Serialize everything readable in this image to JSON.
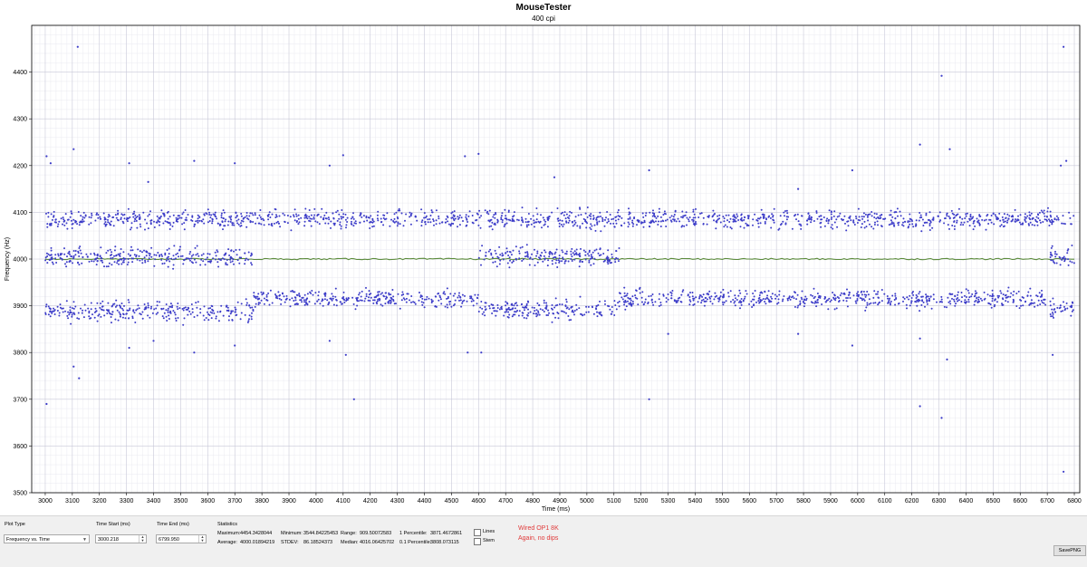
{
  "chart_data": {
    "type": "scatter",
    "title": "MouseTester",
    "subtitle": "400 cpi",
    "xlabel": "Time (ms)",
    "ylabel": "Frequency (Hz)",
    "xlim": [
      2950,
      6820
    ],
    "ylim": [
      3500,
      4500
    ],
    "x_ticks": [
      "3000",
      "3100",
      "3200",
      "3300",
      "3400",
      "3500",
      "3600",
      "3700",
      "3800",
      "3900",
      "4000",
      "4100",
      "4200",
      "4300",
      "4400",
      "4500",
      "4600",
      "4700",
      "4800",
      "4900",
      "5000",
      "5100",
      "5200",
      "5300",
      "5400",
      "5500",
      "5600",
      "5700",
      "5800",
      "5900",
      "6000",
      "6100",
      "6200",
      "6300",
      "6400",
      "6500",
      "6600",
      "6700",
      "6800"
    ],
    "y_ticks": [
      "3500",
      "3600",
      "3700",
      "3800",
      "3900",
      "4000",
      "4100",
      "4200",
      "4300",
      "4400"
    ],
    "grid": true,
    "series": [
      {
        "kind": "points",
        "color": "#3c3cc8",
        "bands": [
          {
            "x_from": 3000.2,
            "x_to": 6800,
            "center": 4085,
            "spread": 14
          },
          {
            "x_from": 3000.2,
            "x_to": 3770,
            "center": 4005,
            "spread": 14
          },
          {
            "x_from": 4600,
            "x_to": 5120,
            "center": 4005,
            "spread": 14
          },
          {
            "x_from": 6710,
            "x_to": 6800,
            "center": 4005,
            "spread": 14
          },
          {
            "x_from": 3000.2,
            "x_to": 3770,
            "center": 3888,
            "spread": 16
          },
          {
            "x_from": 3770,
            "x_to": 4600,
            "center": 3915,
            "spread": 13
          },
          {
            "x_from": 4600,
            "x_to": 5120,
            "center": 3892,
            "spread": 15
          },
          {
            "x_from": 5120,
            "x_to": 6700,
            "center": 3915,
            "spread": 13
          },
          {
            "x_from": 6710,
            "x_to": 6800,
            "center": 3895,
            "spread": 15
          }
        ],
        "outliers": [
          [
            3005,
            4220
          ],
          [
            3020,
            4205
          ],
          [
            3005,
            3690
          ],
          [
            3120,
            4454
          ],
          [
            3105,
            4235
          ],
          [
            3105,
            3770
          ],
          [
            3125,
            3745
          ],
          [
            3310,
            4205
          ],
          [
            3380,
            4165
          ],
          [
            3550,
            4210
          ],
          [
            3700,
            4205
          ],
          [
            3310,
            3810
          ],
          [
            3400,
            3825
          ],
          [
            3550,
            3800
          ],
          [
            3700,
            3815
          ],
          [
            4100,
            4222
          ],
          [
            4050,
            4200
          ],
          [
            4140,
            3700
          ],
          [
            4110,
            3795
          ],
          [
            4050,
            3825
          ],
          [
            4550,
            4220
          ],
          [
            4600,
            4225
          ],
          [
            4560,
            3800
          ],
          [
            4610,
            3800
          ],
          [
            4880,
            4175
          ],
          [
            5230,
            4190
          ],
          [
            5230,
            3700
          ],
          [
            5300,
            3840
          ],
          [
            5780,
            4150
          ],
          [
            5780,
            3840
          ],
          [
            5980,
            4190
          ],
          [
            5980,
            3815
          ],
          [
            6230,
            4245
          ],
          [
            6230,
            3830
          ],
          [
            6230,
            3685
          ],
          [
            6310,
            4392
          ],
          [
            6340,
            4235
          ],
          [
            6310,
            3660
          ],
          [
            6330,
            3785
          ],
          [
            6760,
            4454
          ],
          [
            6760,
            3545
          ],
          [
            6720,
            3795
          ],
          [
            6750,
            4200
          ],
          [
            6770,
            4210
          ],
          [
            6790,
            3900
          ]
        ]
      },
      {
        "kind": "line",
        "name": "",
        "color": "#5a8a3a",
        "y": 4000.0189
      }
    ]
  },
  "controls": {
    "plot_type_label": "Plot Type",
    "plot_type_value": "Frequency vs. Time",
    "time_start_label": "Time Start (ms)",
    "time_start_value": "3000.218",
    "time_end_label": "Time End (ms)",
    "time_end_value": "6799.950",
    "statistics_label": "Statistics",
    "stats": {
      "maximum_label": "Maximum:",
      "maximum_value": "4454.3428044",
      "minimum_label": "Minimum:",
      "minimum_value": "3544.84225453",
      "range_label": "Range:",
      "range_value": "909.50072583",
      "p1_label": "1 Percentile:",
      "p1_value": "3871.4672861",
      "average_label": "Average:",
      "average_value": "4000.01894219",
      "stdev_label": "STDEV:",
      "stdev_value": "86.18524373",
      "median_label": "Median:",
      "median_value": "4016.06425702",
      "p01_label": "0.1 Percentile:",
      "p01_value": "3808.073115"
    },
    "lines_label": "Lines",
    "stem_label": "Stem",
    "note_line1": "Wired OP1 8K",
    "note_line2": "Again, no dips",
    "save_label": "SavePNG"
  },
  "colors": {
    "note": "#e03a3a",
    "points": "#3c3cc8",
    "average_line": "#5a8a3a"
  },
  "icons": {
    "dropdown": "chevron-down-icon",
    "spinner": "spinner-arrows-icon"
  }
}
